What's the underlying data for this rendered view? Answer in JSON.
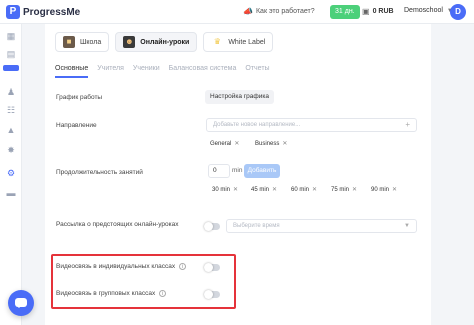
{
  "app": {
    "logo_letter": "P",
    "name": "ProgressMe"
  },
  "header": {
    "howto_label": "Как это работает?",
    "days_badge": "31 дн.",
    "balance": "0 RUB",
    "account_name": "Demoschool",
    "avatar_letter": "D"
  },
  "type_tabs": [
    {
      "label": "Школа"
    },
    {
      "label": "Онлайн-уроки"
    },
    {
      "label": "White Label"
    }
  ],
  "sub_tabs": [
    {
      "label": "Основные"
    },
    {
      "label": "Учителя"
    },
    {
      "label": "Ученики"
    },
    {
      "label": "Балансовая система"
    },
    {
      "label": "Отчеты"
    }
  ],
  "settings": {
    "schedule": {
      "label": "График работы",
      "button": "Настройка графика"
    },
    "direction": {
      "label": "Направление",
      "placeholder": "Добавьте новое направление...",
      "tags": [
        "General",
        "Business"
      ]
    },
    "duration": {
      "label": "Продолжительность занятий",
      "value": "0",
      "unit": "min",
      "add_button": "Добавить",
      "options": [
        "30 min",
        "45 min",
        "60 min",
        "75 min",
        "90 min"
      ]
    },
    "newsletter": {
      "label": "Рассылка о предстоящих онлайн-уроках",
      "placeholder": "Выберите время",
      "enabled": false
    },
    "video_individual": {
      "label": "Видеосвязь в индивидуальных классах",
      "enabled": false
    },
    "video_group": {
      "label": "Видеосвязь в групповых классах",
      "enabled": false
    }
  },
  "colors": {
    "accent": "#4a6cf7",
    "highlight": "#e5333a",
    "badge": "#4cd07a"
  }
}
